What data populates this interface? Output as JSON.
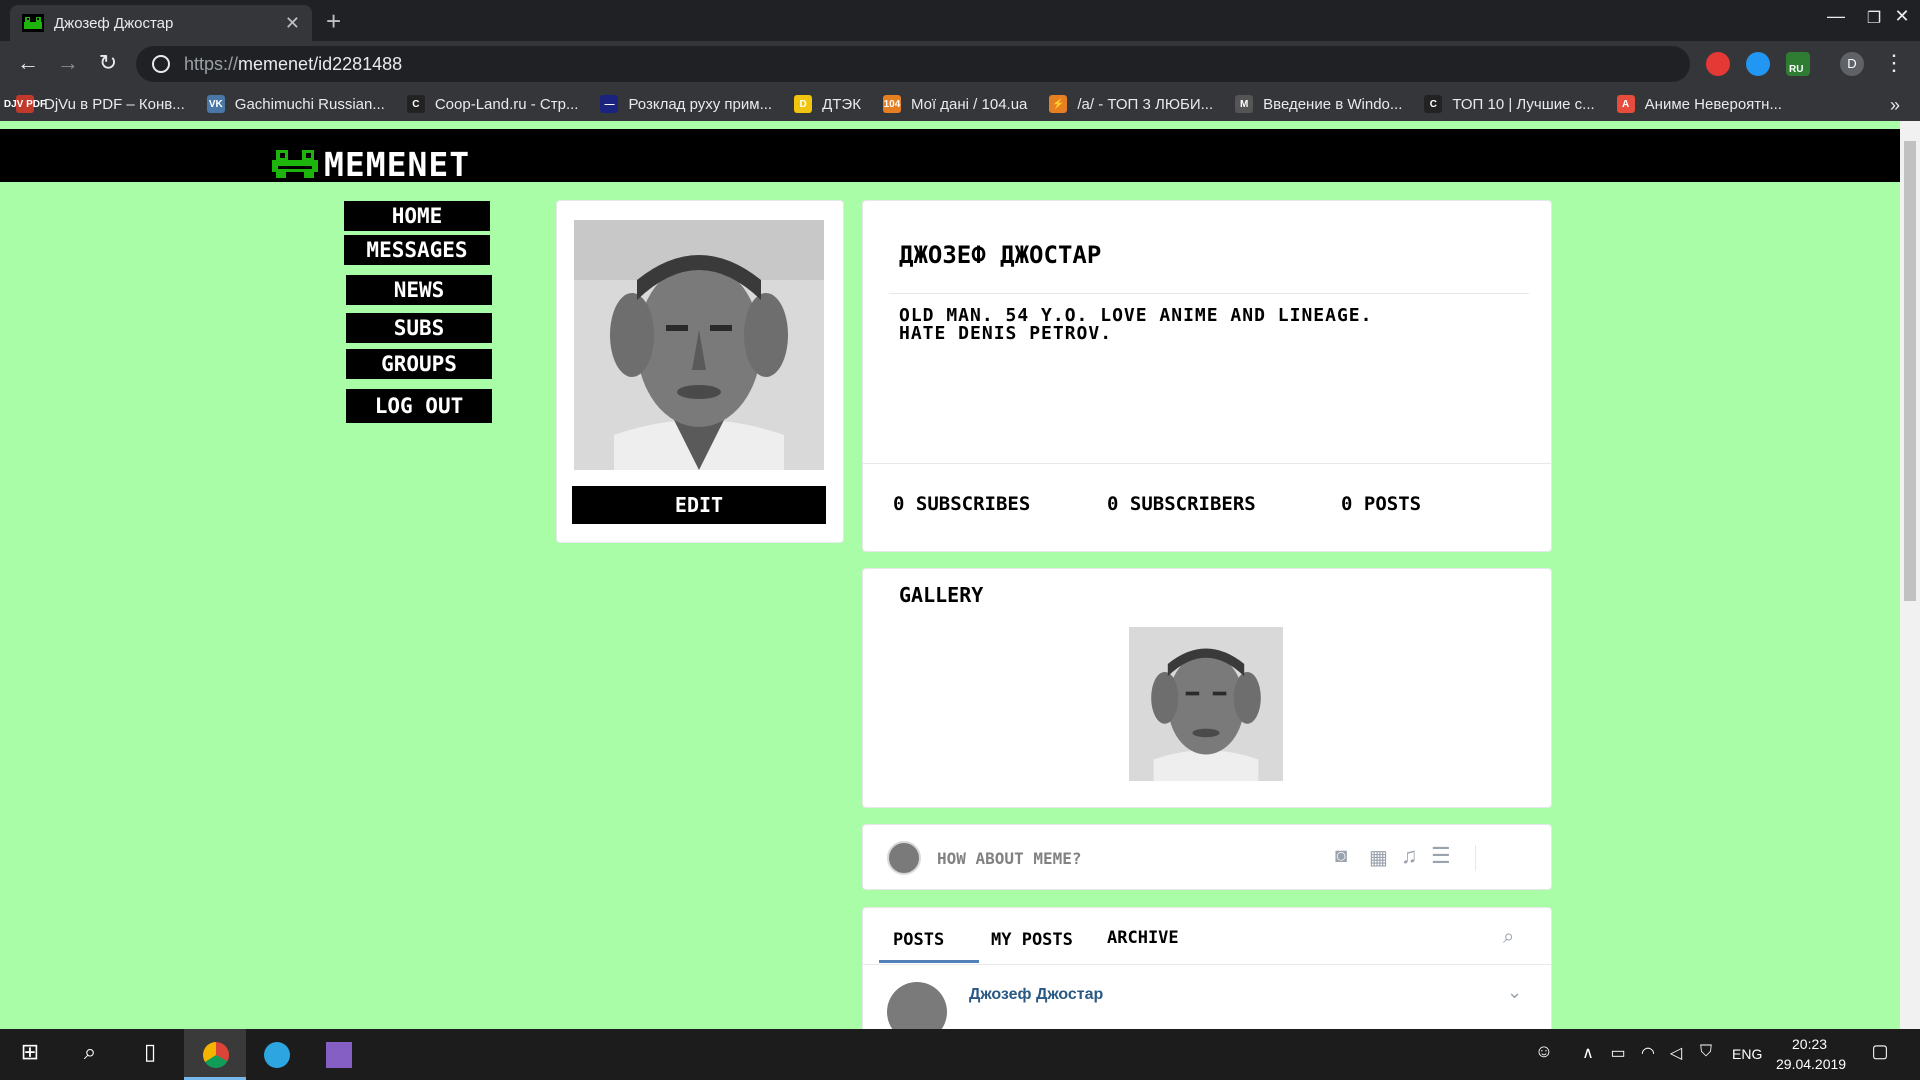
{
  "browser": {
    "tab_title": "Джозеф Джостар",
    "url_scheme": "https://",
    "url_rest": "memenet/id2281488",
    "profile_initial": "D",
    "ext_badge": "RU",
    "bookmarks": [
      {
        "label": "DjVu в PDF – Конв...",
        "icon_text": "DJV PDF",
        "color": "#c0392b"
      },
      {
        "label": "Gachimuchi Russian...",
        "icon_text": "VK",
        "color": "#4a76a8"
      },
      {
        "label": "Coop-Land.ru - Стр...",
        "icon_text": "C",
        "color": "#222"
      },
      {
        "label": "Розклад руху прим...",
        "icon_text": "—",
        "color": "#1a237e"
      },
      {
        "label": "ДТЭК",
        "icon_text": "D",
        "color": "#f1c40f"
      },
      {
        "label": "Мої дані / 104.ua",
        "icon_text": "104",
        "color": "#e67e22"
      },
      {
        "label": "/a/ - ТОП 3 ЛЮБИ...",
        "icon_text": "⚡",
        "color": "#e67e22"
      },
      {
        "label": "Введение в Windo...",
        "icon_text": "M",
        "color": "#555"
      },
      {
        "label": "ТОП 10 | Лучшие с...",
        "icon_text": "C",
        "color": "#222"
      },
      {
        "label": "Аниме Невероятн...",
        "icon_text": "A",
        "color": "#e74c3c"
      }
    ],
    "more_bookmarks": "»"
  },
  "site": {
    "logo": "MEMENET",
    "menu": [
      "HOME",
      "MESSAGES",
      "NEWS",
      "SUBS",
      "GROUPS",
      "LOG OUT"
    ],
    "edit_label": "EDIT",
    "profile_name": "ДЖОЗЕФ ДЖОСТАР",
    "bio_line1": "OLD MAN. 54 Y.O. LOVE ANIME AND LINEAGE.",
    "bio_line2": "HATE DENIS PETROV.",
    "stats": {
      "subscribes": "0 SUBSCRIBES",
      "subscribers": "0 SUBSCRIBERS",
      "posts": "0 POSTS"
    },
    "gallery_title": "GALLERY",
    "composer_placeholder": "HOW ABOUT MEME?",
    "feed_tabs": [
      "POSTS",
      "MY POSTS",
      "ARCHIVE"
    ],
    "post_author": "Джозеф Джостар"
  },
  "taskbar": {
    "lang": "ENG",
    "time": "20:23",
    "date": "29.04.2019"
  },
  "colors": {
    "page_bg": "#a9fda7",
    "header_bg": "#000000",
    "tab_active": "#000000",
    "author_link": "#2a5885",
    "logo_green": "#1db40c"
  }
}
